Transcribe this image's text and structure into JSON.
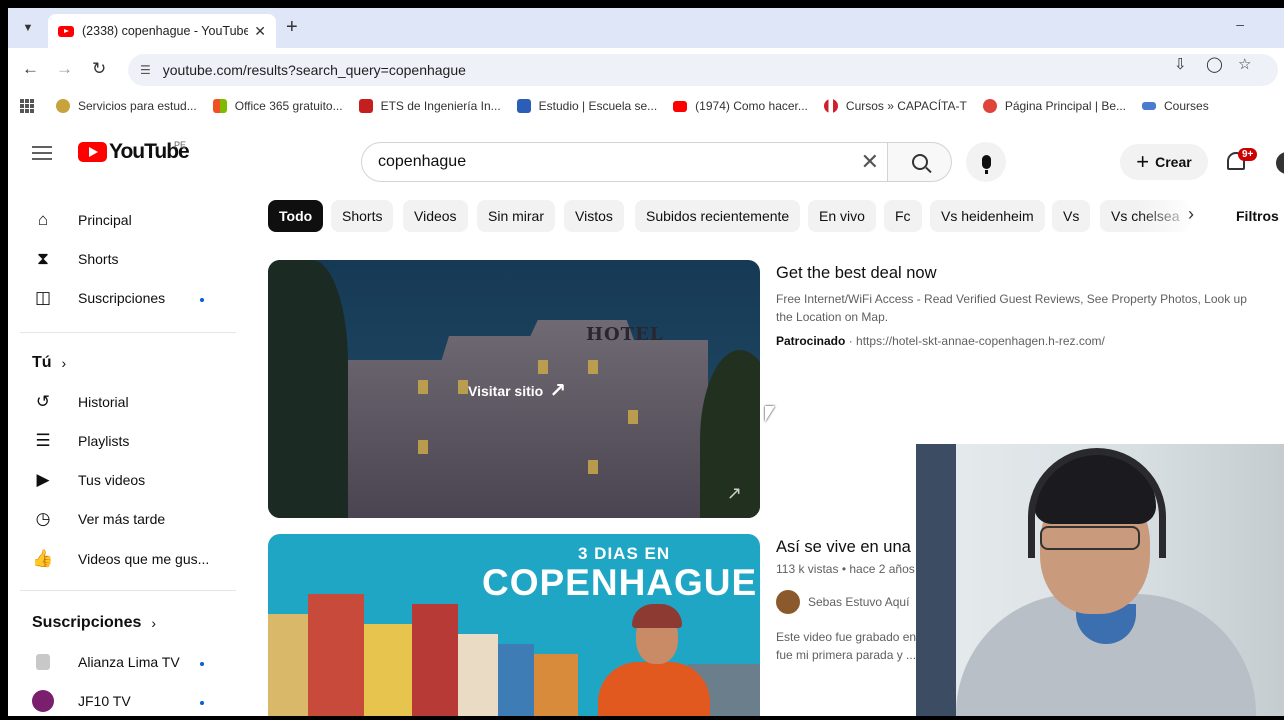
{
  "browser": {
    "tab_title": "(2338) copenhague - YouTube",
    "url": "youtube.com/results?search_query=copenhague",
    "bookmarks": [
      {
        "label": "Servicios para estud...",
        "color": "#c8a23b"
      },
      {
        "label": "Office 365 gratuito...",
        "color": "#f25022"
      },
      {
        "label": "ETS de Ingeniería In...",
        "color": "#c41e1e"
      },
      {
        "label": "Estudio | Escuela se...",
        "color": "#2b5fb7"
      },
      {
        "label": "(1974) Como hacer...",
        "color": "#ff0000"
      },
      {
        "label": "Cursos » CAPACÍTA-T",
        "color": "#d01f2f"
      },
      {
        "label": "Página Principal | Be...",
        "color": "#e0433a"
      },
      {
        "label": "Courses",
        "color": "#4a7bd0"
      }
    ]
  },
  "youtube": {
    "logo_text": "YouTube",
    "country": "PE",
    "search_query": "copenhague",
    "create_label": "Crear",
    "notifications": "9+",
    "sidebar": {
      "main": [
        {
          "label": "Principal",
          "icon": "home-icon"
        },
        {
          "label": "Shorts",
          "icon": "shorts-icon"
        },
        {
          "label": "Suscripciones",
          "icon": "subscriptions-icon",
          "dot": true
        }
      ],
      "you_heading": "Tú",
      "you": [
        {
          "label": "Historial",
          "icon": "history-icon"
        },
        {
          "label": "Playlists",
          "icon": "playlists-icon"
        },
        {
          "label": "Tus videos",
          "icon": "your-videos-icon"
        },
        {
          "label": "Ver más tarde",
          "icon": "watch-later-icon"
        },
        {
          "label": "Videos que me gus...",
          "icon": "liked-videos-icon"
        }
      ],
      "subs_heading": "Suscripciones",
      "subs": [
        {
          "label": "Alianza Lima TV",
          "dot": true
        },
        {
          "label": "JF10 TV",
          "dot": true
        }
      ]
    },
    "chips": [
      "Todo",
      "Shorts",
      "Videos",
      "Sin mirar",
      "Vistos",
      "Subidos recientemente",
      "En vivo",
      "Fc",
      "Vs heidenheim",
      "Vs",
      "Vs chelsea"
    ],
    "filters_label": "Filtros",
    "ad": {
      "title": "Get the best deal now",
      "description": "Free Internet/WiFi Access - Read Verified Guest Reviews, See Property Photos, Look up the Location on Map.",
      "sponsored": "Patrocinado",
      "url": "https://hotel-skt-annae-copenhagen.h-rez.com/",
      "visit_label": "Visitar sitio",
      "sign_text": "HOTEL"
    },
    "video": {
      "thumb_line1": "3 DIAS EN",
      "thumb_line2": "COPENHAGUE",
      "title": "Así se vive en una",
      "views": "113 k vistas",
      "age": "hace 2 años",
      "channel": "Sebas Estuvo Aquí",
      "description": "Este video fue grabado ent fue mi primera parada y ..."
    }
  }
}
